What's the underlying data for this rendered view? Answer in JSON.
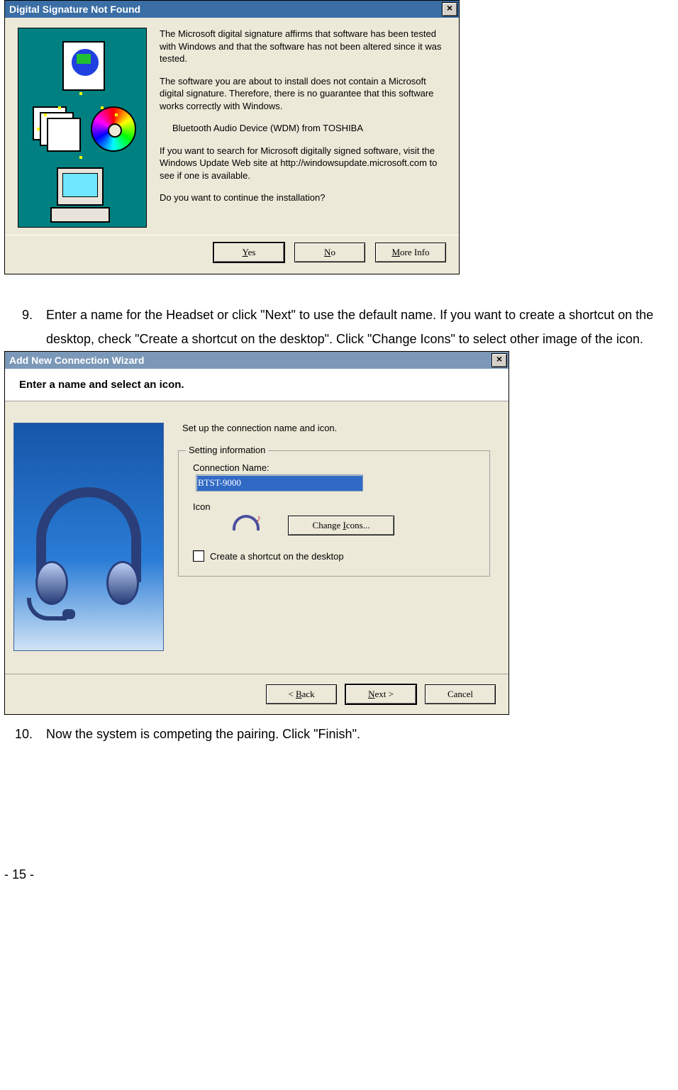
{
  "dialog1": {
    "title": "Digital Signature Not Found",
    "close": "×",
    "para1": "The Microsoft digital signature affirms that software has been tested with Windows and that the software has not been altered since it was tested.",
    "para2": "The software you are about to install does not contain a Microsoft digital signature. Therefore,  there is no guarantee that this software works correctly with Windows.",
    "device": "Bluetooth Audio Device (WDM) from TOSHIBA",
    "para3": "If you want to search for Microsoft digitally signed software, visit the Windows Update Web site at http://windowsupdate.microsoft.com to see if one is available.",
    "para4": "Do you want to continue the installation?",
    "btn_yes": "Yes",
    "btn_no": "No",
    "btn_more": "More Info"
  },
  "step9": {
    "num": "9.",
    "text": "Enter a name for the Headset or click \"Next\" to use the default name. If you want to create a shortcut on the desktop, check \"Create a shortcut on the desktop\". Click \"Change Icons\" to select other image of the icon."
  },
  "dialog2": {
    "title": "Add New Connection Wizard",
    "close": "×",
    "header": "Enter a name and select an icon.",
    "instruction": "Set up the connection name and icon.",
    "group_legend": "Setting information",
    "conn_label": "Connection Name:",
    "conn_value": "BTST-9000",
    "icon_label": "Icon",
    "change_icons": "Change Icons...",
    "shortcut_label": "Create a shortcut on the desktop",
    "btn_back": "< Back",
    "btn_next": "Next >",
    "btn_cancel": "Cancel"
  },
  "step10": {
    "num": "10.",
    "text": "Now the system is competing the pairing. Click \"Finish\"."
  },
  "footer": "- 15 -"
}
